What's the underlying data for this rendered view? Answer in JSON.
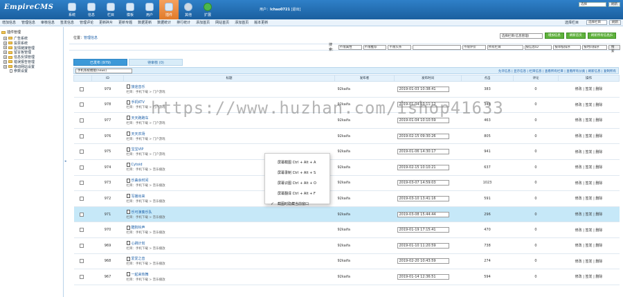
{
  "header": {
    "logo": "EmpireCMS",
    "nav": [
      {
        "label": "系统",
        "icon": "system-icon"
      },
      {
        "label": "信息",
        "icon": "info-icon"
      },
      {
        "label": "栏目",
        "icon": "column-icon"
      },
      {
        "label": "模板",
        "icon": "template-icon"
      },
      {
        "label": "用户",
        "icon": "user-icon"
      },
      {
        "label": "插件",
        "icon": "plugin-icon",
        "active": true
      },
      {
        "label": "其他",
        "icon": "gear-icon"
      },
      {
        "label": "扩展",
        "icon": "plus-icon"
      }
    ],
    "user_prefix": "用户：",
    "username": "lchao0721",
    "logout": "[退出]",
    "top_select": "选择",
    "top_btn": "刷新"
  },
  "menubar": {
    "items": [
      "增加信息",
      "管理信息",
      "审核信息",
      "签发信息",
      "管理评论",
      "更新碎片",
      "更新专题",
      "数据更新",
      "数据统计",
      "排行统计",
      "添加首页",
      "网站首页",
      "添加首页",
      "版本更新"
    ],
    "right_label": "选择栏目",
    "right_select": "选择栏目",
    "right_btn": "刷新"
  },
  "sidebar": {
    "root": "插件管理",
    "items": [
      "广告系统",
      "投票系统",
      "友情链接管理",
      "留言板管理",
      "信息反馈管理",
      "错误报告管理",
      "移动网站设置"
    ],
    "sub": [
      "参数设置"
    ],
    "toggle": "◂"
  },
  "main": {
    "breadcrumb_prefix": "位置：",
    "breadcrumb_link": "管理信息",
    "actions": {
      "select": "选择栏目(信息管理)",
      "btn1": "增加信息",
      "btn2": "刷新首页",
      "btn3": "刷新所有信息JS"
    },
    "search": {
      "label": "搜索:",
      "selects": [
        "不限属性",
        "不限推荐",
        "不限头条",
        "不限评价",
        "所有栏目",
        "按信息ID",
        "按审核排序",
        "按时间排序"
      ],
      "button": "搜索"
    },
    "tabs": [
      "已发布 (979)",
      "待审核 (0)"
    ],
    "list_select": "手机系统模版(news)",
    "toolbar_links": "允许信息 | 显示信息 | 栏目信息 | 查看所有栏目 | 查看所有分类 | 刷新信息 | 复制所有"
  },
  "table": {
    "headers": [
      "",
      "ID",
      "标题",
      "发布者",
      "发布时间",
      "点击",
      "评论",
      "操作"
    ],
    "rows": [
      {
        "id": "979",
        "title": "旅途音乐",
        "column": "栏目：手机下载 > 门户游戏",
        "publisher": "92kaifa",
        "time": "2019-01-03 10:38:41",
        "clicks": "383",
        "comments": "0",
        "ops": "修改 | 签发 | 删除"
      },
      {
        "id": "978",
        "title": "手机KTV",
        "column": "栏目：手机下载 > 门户游戏",
        "publisher": "92kaifa",
        "time": "2019-01-04 10:11:12",
        "clicks": "348",
        "comments": "0",
        "ops": "修改 | 签发 | 删除"
      },
      {
        "id": "977",
        "title": "天天跑跑车",
        "column": "栏目：手机下载 > 门户游戏",
        "publisher": "92kaifa",
        "time": "2019-01-04 10:10:59",
        "clicks": "463",
        "comments": "0",
        "ops": "修改 | 签发 | 删除"
      },
      {
        "id": "976",
        "title": "天天农场",
        "column": "栏目：手机下载 > 门户游戏",
        "publisher": "92kaifa",
        "time": "2019-02-15 09:30:26",
        "clicks": "805",
        "comments": "0",
        "ops": "修改 | 签发 | 删除"
      },
      {
        "id": "975",
        "title": "宝宝VIP",
        "column": "栏目：手机下载 > 门户游戏",
        "publisher": "92kaifa",
        "time": "2019-01-06 14:30:17",
        "clicks": "941",
        "comments": "0",
        "ops": "修改 | 签发 | 删除"
      },
      {
        "id": "974",
        "title": "Cytoid",
        "column": "栏目：手机下载 > 音乐播放",
        "publisher": "92kaifa",
        "time": "2019-02-15 10:10:21",
        "clicks": "637",
        "comments": "0",
        "ops": "修改 | 签发 | 删除"
      },
      {
        "id": "973",
        "title": "乐曲余时间",
        "column": "栏目：手机下载 > 音乐播放",
        "publisher": "92kaifa",
        "time": "2019-03-07 14:59:03",
        "clicks": "1023",
        "comments": "0",
        "ops": "修改 | 签发 | 删除"
      },
      {
        "id": "972",
        "title": "写播出来",
        "column": "栏目：手机下载 > 音乐播放",
        "publisher": "92kaifa",
        "time": "2019-03-10 13:41:16",
        "clicks": "591",
        "comments": "0",
        "ops": "修改 | 签发 | 删除"
      },
      {
        "id": "971",
        "title": "乐可演奏乐队",
        "column": "栏目：手机下载 > 音乐播放",
        "publisher": "92kaifa",
        "time": "2019-03-08 15:44:44",
        "clicks": "296",
        "comments": "0",
        "ops": "修改 | 签发 | 删除",
        "highlight": true
      },
      {
        "id": "970",
        "title": "酷狗铃声",
        "column": "栏目：手机下载 > 音乐播放",
        "publisher": "92kaifa",
        "time": "2019-01-19 17:15:41",
        "clicks": "470",
        "comments": "0",
        "ops": "修改 | 签发 | 删除"
      },
      {
        "id": "969",
        "title": "心跳计划",
        "column": "栏目：手机下载 > 音乐播放",
        "publisher": "92kaifa",
        "time": "2019-01-10 11:20:59",
        "clicks": "738",
        "comments": "0",
        "ops": "修改 | 签发 | 删除"
      },
      {
        "id": "968",
        "title": "爱爱之音",
        "column": "栏目：手机下载 > 音乐播放",
        "publisher": "92kaifa",
        "time": "2019-02-20 10:43:59",
        "clicks": "274",
        "comments": "0",
        "ops": "修改 | 签发 | 删除"
      },
      {
        "id": "967",
        "title": "一起来热舞",
        "column": "栏目：手机下载 > 音乐播放",
        "publisher": "92kaifa",
        "time": "2019-01-14 12:36:51",
        "clicks": "594",
        "comments": "0",
        "ops": "修改 | 签发 | 删除"
      }
    ]
  },
  "context_menu": {
    "items": [
      {
        "label": "屏幕截图 Ctrl + Alt + A"
      },
      {
        "label": "屏幕录制 Ctrl + Alt + S"
      },
      {
        "label": "屏幕识图 Ctrl + Alt + O"
      },
      {
        "label": "屏幕翻译 Ctrl + Alt + F"
      },
      {
        "label": "截图时隐藏当前窗口",
        "checked": true
      }
    ],
    "check": "✓"
  },
  "watermark": "https://www.huzhan.com/ishop41633"
}
